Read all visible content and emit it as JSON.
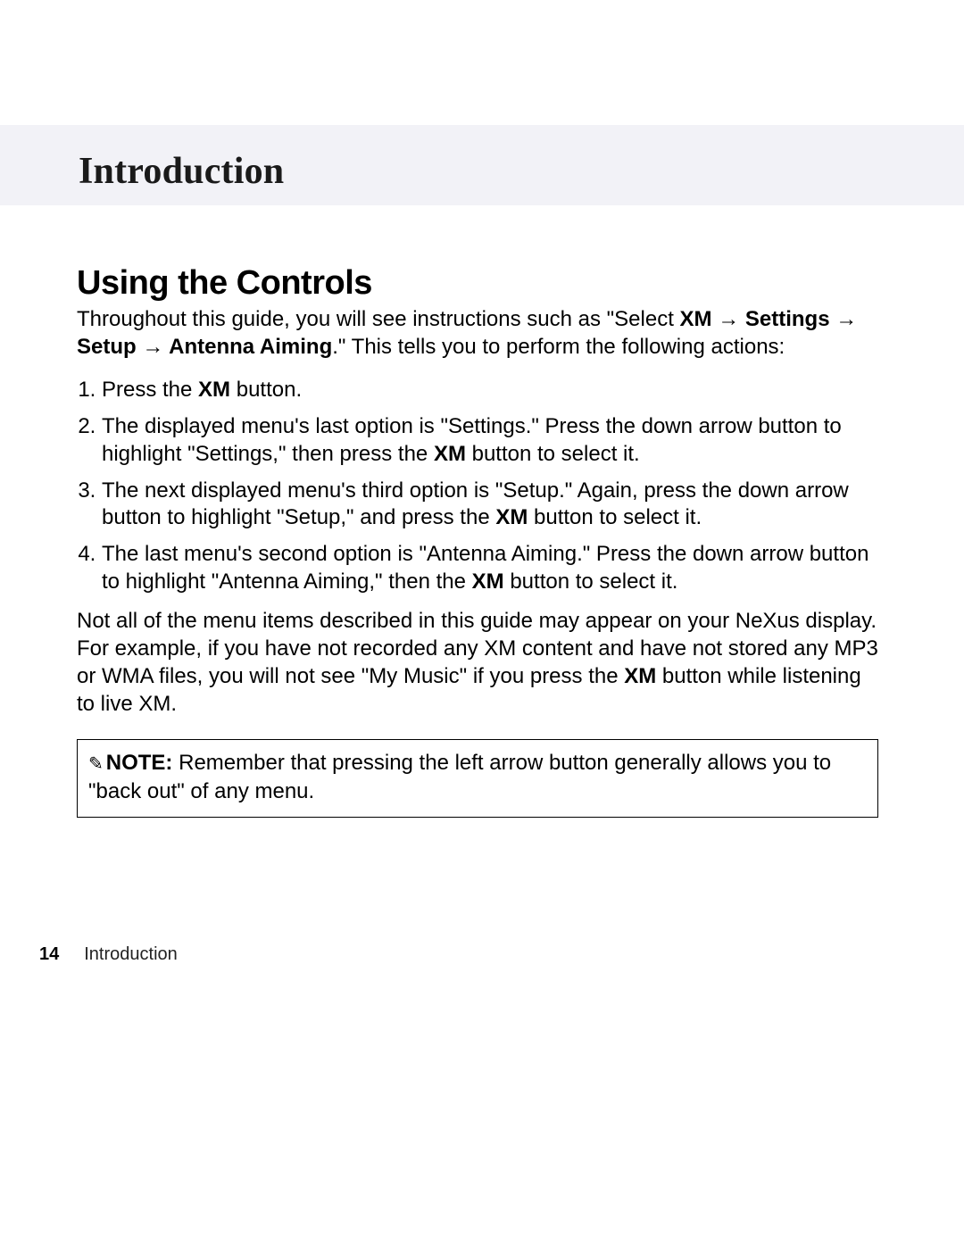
{
  "section_title": "Introduction",
  "heading": "Using the Controls",
  "intro": {
    "pre": "Throughout this guide, you will see instructions such as \"Select ",
    "path": [
      {
        "label": "XM",
        "bold": true
      },
      {
        "label": "Settings",
        "bold": true
      },
      {
        "label": "Setup",
        "bold": true
      },
      {
        "label": "Antenna Aiming",
        "bold": true
      }
    ],
    "arrow": " → ",
    "post": ".\" This tells you to perform the following actions:"
  },
  "steps": [
    {
      "pre": "Press the ",
      "bold": "XM",
      "post": " button."
    },
    {
      "pre": "The displayed menu's last option is \"Settings.\" Press the down arrow button to highlight \"Settings,\" then press the ",
      "bold": "XM",
      "post": " button to select it."
    },
    {
      "pre": "The next displayed menu's third option is \"Setup.\" Again, press the down arrow button to highlight \"Setup,\" and press the ",
      "bold": "XM",
      "post": " button to select it."
    },
    {
      "pre": "The last menu's second option is \"Antenna Aiming.\" Press the down arrow button to highlight \"Antenna Aiming,\" then the ",
      "bold": "XM",
      "post": " button to select it."
    }
  ],
  "closing": {
    "pre": "Not all of the menu items described in this guide may appear on your NeXus display. For example, if you have not recorded any XM content and have not stored any MP3 or WMA files, you will not see \"My Music\" if you press the ",
    "bold": "XM",
    "post": " button while listening to live XM."
  },
  "note": {
    "label": "NOTE:",
    "text": " Remember that pressing the left arrow button generally allows you to \"back out\" of any menu.",
    "icon": "✎"
  },
  "footer": {
    "page": "14",
    "label": "Introduction"
  }
}
